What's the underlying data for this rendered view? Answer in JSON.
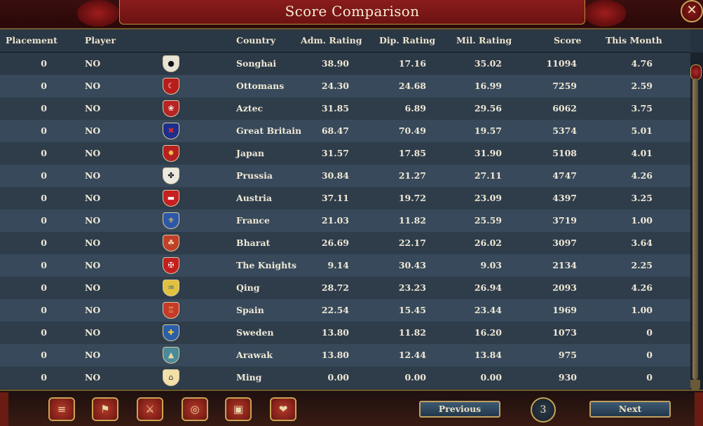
{
  "window": {
    "title": "Score Comparison",
    "close_label": "✕"
  },
  "columns": [
    "Placement",
    "Player",
    "Country",
    "Adm. Rating",
    "Dip. Rating",
    "Mil. Rating",
    "Score",
    "This Month"
  ],
  "rows": [
    {
      "placement": "0",
      "player": "NO",
      "country": "Songhai",
      "adm": "38.90",
      "dip": "17.16",
      "mil": "35.02",
      "score": "11094",
      "month": "4.76",
      "flag_icon": "songhai-flag-icon",
      "flag_bg": "#e8e3d6",
      "flag_fg": "#111111",
      "flag_glyph": "●"
    },
    {
      "placement": "0",
      "player": "NO",
      "country": "Ottomans",
      "adm": "24.30",
      "dip": "24.68",
      "mil": "16.99",
      "score": "7259",
      "month": "2.59",
      "flag_icon": "ottomans-flag-icon",
      "flag_bg": "#b81c1c",
      "flag_fg": "#f3efe6",
      "flag_glyph": "☾"
    },
    {
      "placement": "0",
      "player": "NO",
      "country": "Aztec",
      "adm": "31.85",
      "dip": "6.89",
      "mil": "29.56",
      "score": "6062",
      "month": "3.75",
      "flag_icon": "aztec-flag-icon",
      "flag_bg": "#b82424",
      "flag_fg": "#f5eee0",
      "flag_glyph": "❀"
    },
    {
      "placement": "0",
      "player": "NO",
      "country": "Great Britain",
      "adm": "68.47",
      "dip": "70.49",
      "mil": "19.57",
      "score": "5374",
      "month": "5.01",
      "flag_icon": "great-britain-flag-icon",
      "flag_bg": "#1d2f8a",
      "flag_fg": "#e02b2b",
      "flag_glyph": "✖"
    },
    {
      "placement": "0",
      "player": "NO",
      "country": "Japan",
      "adm": "31.57",
      "dip": "17.85",
      "mil": "31.90",
      "score": "5108",
      "month": "4.01",
      "flag_icon": "japan-flag-icon",
      "flag_bg": "#b52020",
      "flag_fg": "#f2c84a",
      "flag_glyph": "✸"
    },
    {
      "placement": "0",
      "player": "NO",
      "country": "Prussia",
      "adm": "30.84",
      "dip": "21.27",
      "mil": "27.11",
      "score": "4747",
      "month": "4.26",
      "flag_icon": "prussia-flag-icon",
      "flag_bg": "#ece9e0",
      "flag_fg": "#111111",
      "flag_glyph": "✤"
    },
    {
      "placement": "0",
      "player": "NO",
      "country": "Austria",
      "adm": "37.11",
      "dip": "19.72",
      "mil": "23.09",
      "score": "4397",
      "month": "3.25",
      "flag_icon": "austria-flag-icon",
      "flag_bg": "#c62020",
      "flag_fg": "#f4f0e8",
      "flag_glyph": "▬"
    },
    {
      "placement": "0",
      "player": "NO",
      "country": "France",
      "adm": "21.03",
      "dip": "11.82",
      "mil": "25.59",
      "score": "3719",
      "month": "1.00",
      "flag_icon": "france-flag-icon",
      "flag_bg": "#2d57a8",
      "flag_fg": "#f1cf4c",
      "flag_glyph": "⚜"
    },
    {
      "placement": "0",
      "player": "NO",
      "country": "Bharat",
      "adm": "26.69",
      "dip": "22.17",
      "mil": "26.02",
      "score": "3097",
      "month": "3.64",
      "flag_icon": "bharat-flag-icon",
      "flag_bg": "#c0402a",
      "flag_fg": "#f2e2b0",
      "flag_glyph": "☘"
    },
    {
      "placement": "0",
      "player": "NO",
      "country": "The Knights",
      "adm": "9.14",
      "dip": "30.43",
      "mil": "9.03",
      "score": "2134",
      "month": "2.25",
      "flag_icon": "the-knights-flag-icon",
      "flag_bg": "#c31f1f",
      "flag_fg": "#f4f0ea",
      "flag_glyph": "✠"
    },
    {
      "placement": "0",
      "player": "NO",
      "country": "Qing",
      "adm": "28.72",
      "dip": "23.23",
      "mil": "26.94",
      "score": "2093",
      "month": "4.26",
      "flag_icon": "qing-flag-icon",
      "flag_bg": "#e0c13e",
      "flag_fg": "#2b5aa3",
      "flag_glyph": "♒"
    },
    {
      "placement": "0",
      "player": "NO",
      "country": "Spain",
      "adm": "22.54",
      "dip": "15.45",
      "mil": "23.44",
      "score": "1969",
      "month": "1.00",
      "flag_icon": "spain-flag-icon",
      "flag_bg": "#c53a2a",
      "flag_fg": "#f2d36a",
      "flag_glyph": "♖"
    },
    {
      "placement": "0",
      "player": "NO",
      "country": "Sweden",
      "adm": "13.80",
      "dip": "11.82",
      "mil": "16.20",
      "score": "1073",
      "month": "0",
      "flag_icon": "sweden-flag-icon",
      "flag_bg": "#2a5ea8",
      "flag_fg": "#f0c934",
      "flag_glyph": "✚"
    },
    {
      "placement": "0",
      "player": "NO",
      "country": "Arawak",
      "adm": "13.80",
      "dip": "12.44",
      "mil": "13.84",
      "score": "975",
      "month": "0",
      "flag_icon": "arawak-flag-icon",
      "flag_bg": "#4a8a9a",
      "flag_fg": "#e8d7a3",
      "flag_glyph": "▲"
    },
    {
      "placement": "0",
      "player": "NO",
      "country": "Ming",
      "adm": "0.00",
      "dip": "0.00",
      "mil": "0.00",
      "score": "930",
      "month": "0",
      "flag_icon": "ming-flag-icon",
      "flag_bg": "#f2e0a8",
      "flag_fg": "#3a3a3a",
      "flag_glyph": "⌂"
    }
  ],
  "bottom_icons": [
    {
      "name": "ledger-icon",
      "glyph": "≡"
    },
    {
      "name": "flag-icon",
      "glyph": "⚑"
    },
    {
      "name": "crossed-swords-icon",
      "glyph": "⚔"
    },
    {
      "name": "coins-icon",
      "glyph": "◎"
    },
    {
      "name": "crate-icon",
      "glyph": "▣"
    },
    {
      "name": "handshake-icon",
      "glyph": "❤"
    }
  ],
  "pagination": {
    "previous_label": "Previous",
    "next_label": "Next",
    "page": "3"
  },
  "colors": {
    "accent_gold": "#c9a455",
    "title_red": "#8a1c1c",
    "row_light": "#37495a",
    "row_dark": "#2f3d4b"
  }
}
